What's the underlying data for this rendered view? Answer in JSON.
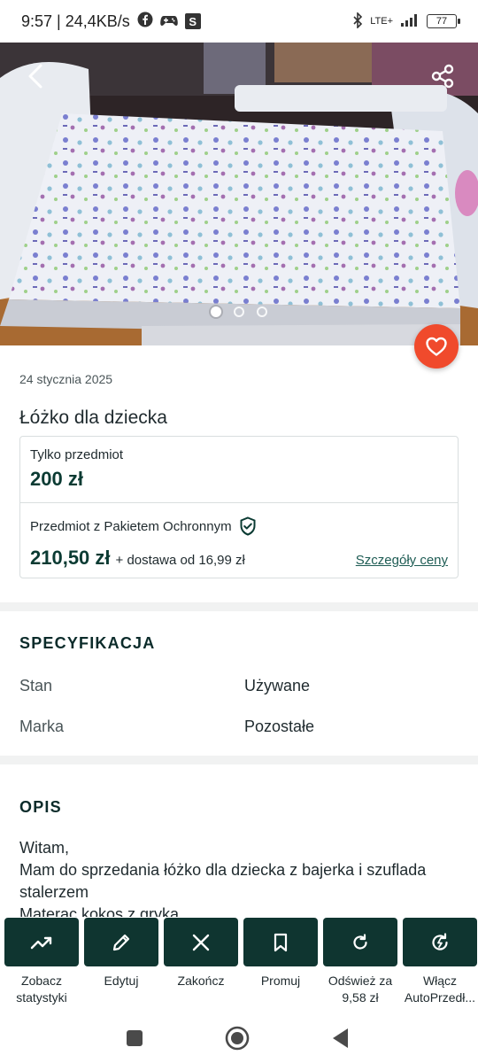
{
  "status_bar": {
    "time_speed": "9:57 | 24,4KB/s",
    "network": "LTE+",
    "battery": "77"
  },
  "listing": {
    "date": "24 stycznia 2025",
    "title": "Łóżko dla dziecka",
    "photos_count": 3,
    "active_photo": 1
  },
  "pricing": {
    "item_only_label": "Tylko przedmiot",
    "item_only_price": "200 zł",
    "protected_label": "Przedmiot z Pakietem Ochronnym",
    "protected_price": "210,50 zł",
    "shipping": "+ dostawa od 16,99 zł",
    "details_link": "Szczegóły ceny"
  },
  "specs": {
    "title": "SPECYFIKACJA",
    "rows": [
      {
        "key": "Stan",
        "value": "Używane"
      },
      {
        "key": "Marka",
        "value": "Pozostałe"
      }
    ]
  },
  "description": {
    "title": "OPIS",
    "text": "Witam,\nMam do sprzedania łóżko dla dziecka z bajerka i szuflada stalerzem\nMaterac kokos z gryka"
  },
  "actions": [
    {
      "label": "Zobacz statystyki",
      "icon": "trending-up-icon"
    },
    {
      "label": "Edytuj",
      "icon": "pencil-icon"
    },
    {
      "label": "Zakończ",
      "icon": "close-icon"
    },
    {
      "label": "Promuj",
      "icon": "bookmark-icon"
    },
    {
      "label": "Odśwież za 9,58 zł",
      "icon": "refresh-icon"
    },
    {
      "label": "Włącz AutoPrzedł...",
      "icon": "auto-renew-icon"
    }
  ],
  "colors": {
    "accent_dark": "#0f3530",
    "favorite": "#f04a2c",
    "link": "#1e5c54"
  }
}
